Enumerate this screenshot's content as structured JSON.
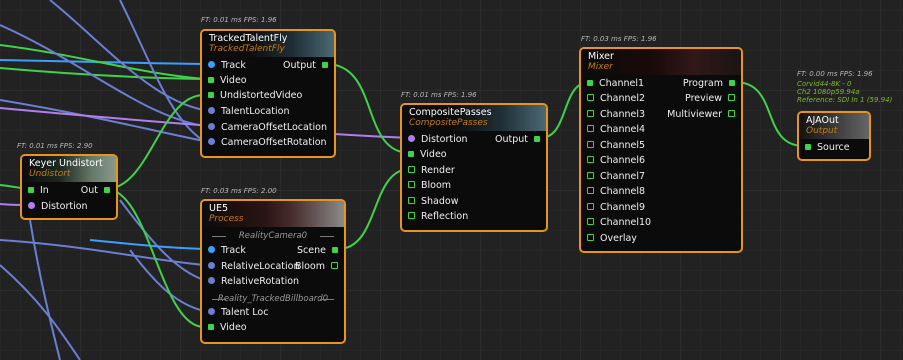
{
  "colors": {
    "exec": "#3a9fff",
    "video": "#3fd24a",
    "transform": "#6a7fd2",
    "distortion": "#b07ef0",
    "border": "#e8951f"
  },
  "nodes": {
    "tracked": {
      "title": "TrackedTalentFly",
      "subtitle": "TrackedTalentFly",
      "ft": "FT: 0.01 ms FPS: 1.96",
      "pins": {
        "track": "Track",
        "video": "Video",
        "undistorted": "UndistortedVideo",
        "talent_loc": "TalentLocation",
        "cam_off_loc": "CameraOffsetLocation",
        "cam_off_rot": "CameraOffsetRotation",
        "output": "Output"
      }
    },
    "keyer": {
      "title": "Keyer Undistort",
      "subtitle": "Undistort",
      "ft": "FT: 0.01 ms FPS: 2.90",
      "pins": {
        "in": "In",
        "out": "Out",
        "distortion": "Distortion"
      }
    },
    "ue5": {
      "title": "UE5",
      "subtitle": "Process",
      "ft": "FT: 0.03 ms FPS: 2.00",
      "sep1": "RealityCamera0",
      "sep2": "Reality_TrackedBillboard0",
      "pins": {
        "track": "Track",
        "rel_loc": "RelativeLocation",
        "rel_rot": "RelativeRotation",
        "scene": "Scene",
        "bloom": "Bloom",
        "talent_loc": "Talent Loc",
        "video": "Video"
      }
    },
    "composite": {
      "title": "CompositePasses",
      "subtitle": "CompositePasses",
      "ft": "FT: 0.01 ms FPS: 1.96",
      "pins": {
        "distortion": "Distortion",
        "video": "Video",
        "render": "Render",
        "bloom": "Bloom",
        "shadow": "Shadow",
        "reflection": "Reflection",
        "output": "Output"
      }
    },
    "mixer": {
      "title": "Mixer",
      "subtitle": "Mixer",
      "ft": "FT: 0.03 ms FPS: 1.96",
      "channels": [
        "Channel1",
        "Channel2",
        "Channel3",
        "Channel4",
        "Channel5",
        "Channel6",
        "Channel7",
        "Channel8",
        "Channel9",
        "Channel10",
        "Overlay"
      ],
      "outputs": {
        "program": "Program",
        "preview": "Preview",
        "multiviewer": "Multiviewer"
      }
    },
    "aja": {
      "title": "AJAOut",
      "subtitle": "Output",
      "ft": "FT: 0.00 ms FPS: 1.96",
      "info": [
        "Corvid44-8K - 0",
        "Ch2 1080p59.94a",
        "Reference: SDI In 1 (59.94)"
      ],
      "pins": {
        "source": "Source"
      }
    }
  }
}
